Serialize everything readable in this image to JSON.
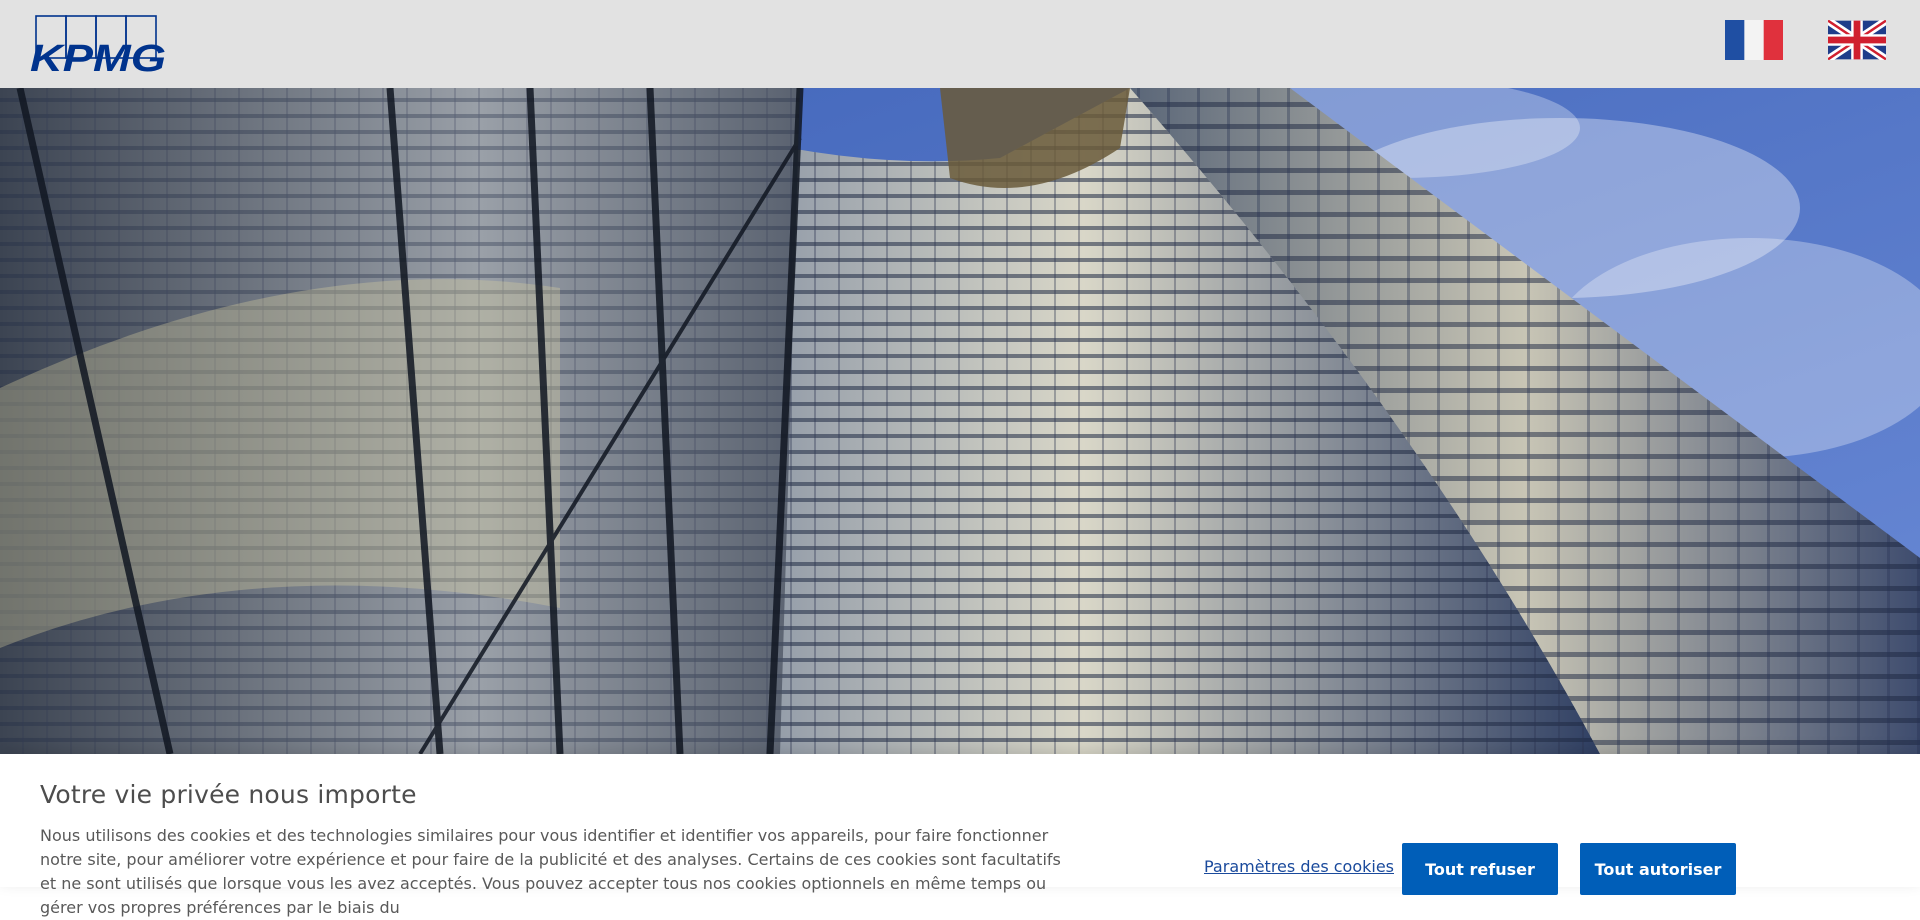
{
  "header": {
    "logo_text": "KPMG",
    "logo_color": "#00338d",
    "languages": [
      {
        "code": "fr",
        "icon": "flag-france-icon"
      },
      {
        "code": "en",
        "icon": "flag-uk-icon"
      }
    ]
  },
  "hero": {
    "image": "skyscraper-photo"
  },
  "cookie_banner": {
    "title": "Votre vie privée nous importe",
    "body": "Nous utilisons des cookies et des technologies similaires pour vous identifier et identifier vos appareils, pour faire fonctionner notre site, pour améliorer votre expérience et pour faire de la publicité et des analyses. Certains de ces cookies sont facultatifs et ne sont utilisés que lorsque vous les avez acceptés. Vous pouvez accepter tous nos cookies optionnels en même temps ou gérer vos propres préférences par le biais du",
    "settings_label": "Paramètres des cookies",
    "refuse_label": "Tout refuser",
    "accept_label": "Tout autoriser",
    "button_color": "#005eb8"
  }
}
